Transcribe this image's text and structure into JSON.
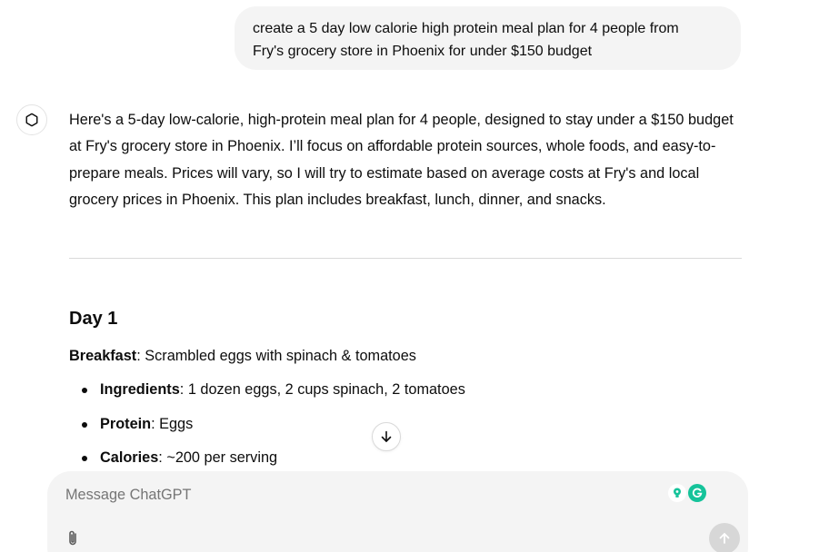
{
  "user_message": {
    "line1": "create a 5 day low calorie high protein meal plan for 4 people from",
    "line2": "Fry's grocery store in Phoenix for under $150 budget"
  },
  "assistant": {
    "intro": "Here's a 5-day low-calorie, high-protein meal plan for 4 people, designed to stay under a $150 budget at Fry's grocery store in Phoenix. I’ll focus on affordable protein sources, whole foods, and easy-to-prepare meals. Prices will vary, so I will try to estimate based on average costs at Fry's and local grocery prices in Phoenix. This plan includes breakfast, lunch, dinner, and snacks.",
    "day_heading": "Day 1",
    "meal": {
      "label": "Breakfast",
      "text": ": Scrambled eggs with spinach & tomatoes"
    },
    "bullets": [
      {
        "label": "Ingredients",
        "text": ": 1 dozen eggs, 2 cups spinach, 2 tomatoes"
      },
      {
        "label": "Protein",
        "text": ": Eggs"
      },
      {
        "label": "Calories",
        "text": ": ~200 per serving"
      }
    ]
  },
  "composer": {
    "placeholder": "Message ChatGPT"
  },
  "icons": {
    "avatar": "openai-logo-icon",
    "scroll": "arrow-down-icon",
    "attach": "paperclip-icon",
    "send": "arrow-up-icon",
    "grammarly_bulb": "lightbulb-icon",
    "grammarly_logo": "grammarly-icon"
  },
  "colors": {
    "bubble_bg": "#f4f4f4",
    "composer_bg": "#f4f4f4",
    "send_disabled": "#d7d7d7",
    "grammarly_green": "#15c39a"
  }
}
